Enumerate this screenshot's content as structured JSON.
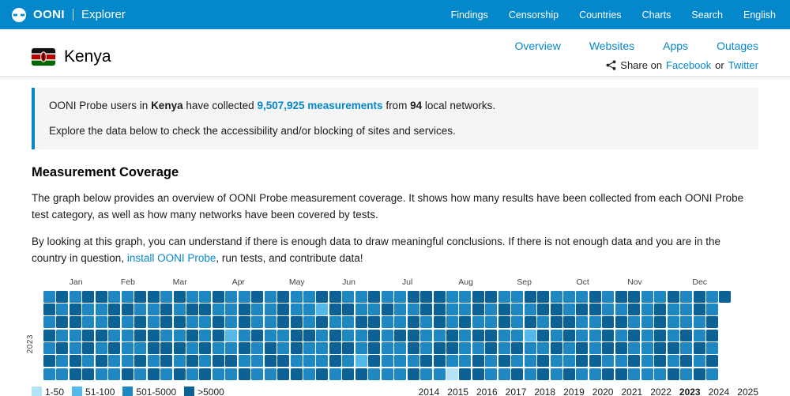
{
  "navbar": {
    "brand": "OONI",
    "brand_sub": "Explorer",
    "items": [
      "Findings",
      "Censorship",
      "Countries",
      "Charts",
      "Search",
      "English"
    ]
  },
  "header": {
    "country": "Kenya",
    "links": [
      "Overview",
      "Websites",
      "Apps",
      "Outages"
    ],
    "share": {
      "prefix": "Share on",
      "facebook": "Facebook",
      "or": "or",
      "twitter": "Twitter"
    }
  },
  "intro": {
    "line1": {
      "p1": "OONI Probe users in",
      "country": "Kenya",
      "p2": "have collected",
      "link": "9,507,925 measurements",
      "p3": "from",
      "networks": "94",
      "p4": "local networks."
    },
    "line2": "Explore the data below to check the accessibility and/or blocking of sites and services."
  },
  "section": {
    "title": "Measurement Coverage",
    "para1": "The graph below provides an overview of OONI Probe measurement coverage. It shows how many results have been collected from each OONI Probe test category, as well as how many networks have been covered by tests.",
    "para2_pre": "By looking at this graph, you can understand if there is enough data to draw meaningful conclusions. If there is not enough data and you are in the country in question, ",
    "para2_link": "install OONI Probe",
    "para2_post": ", run tests, and contribute data!"
  },
  "chart_data": {
    "type": "heatmap",
    "title": "Measurement Coverage heatmap, Kenya 2023",
    "year_label": "2023",
    "weeks": 53,
    "months": [
      "Jan",
      "Feb",
      "Mar",
      "Apr",
      "May",
      "Jun",
      "Jul",
      "Aug",
      "Sep",
      "Oct",
      "Nov",
      "Dec"
    ],
    "month_start_weeks": [
      0,
      4,
      8,
      12,
      17,
      21,
      25,
      30,
      34,
      39,
      43,
      47
    ],
    "legend": [
      {
        "label": "1-50",
        "color": "#b3e3f6"
      },
      {
        "label": "51-100",
        "color": "#54b9e9"
      },
      {
        "label": "501-5000",
        "color": "#1f88c3"
      },
      {
        "label": ">5000",
        "color": "#0d6295"
      }
    ],
    "rows": [
      [
        "2323322332",
        "3223223232",
        "2332232233",
        "3223322332",
        "2232332232",
        "323"
      ],
      [
        "3232233223",
        "2332232232",
        "2133223223",
        "3223232233",
        "2332232322",
        "32"
      ],
      [
        "2332232323",
        "3223232233",
        "2322332232",
        "3232232323",
        "3223322322",
        "23"
      ],
      [
        "3223322332",
        "2323123223",
        "3232232332",
        "2323322132",
        "3223232323",
        "23"
      ],
      [
        "2323232233",
        "3232232323",
        "2233232232",
        "3322323223",
        "2323322332",
        "32"
      ],
      [
        "3232322323",
        "2323322332",
        "2232132223",
        "3223232232",
        "2332232323",
        "23"
      ],
      [
        "2233223232",
        "3232232233",
        "2323322232",
        "2033223232",
        "3223322232",
        "32"
      ]
    ]
  },
  "years": {
    "items": [
      "2014",
      "2015",
      "2016",
      "2017",
      "2018",
      "2019",
      "2020",
      "2021",
      "2022",
      "2023",
      "2024",
      "2025"
    ],
    "selected": "2023"
  },
  "colors": {
    "brand": "#0588CB"
  }
}
